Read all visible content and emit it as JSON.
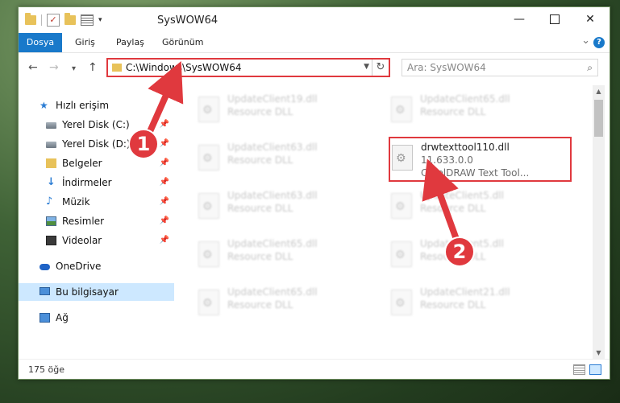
{
  "window": {
    "title": "SysWOW64"
  },
  "ribbon": {
    "tabs": [
      "Dosya",
      "Giriş",
      "Paylaş",
      "Görünüm"
    ]
  },
  "address": {
    "path": "C:\\Windows\\SysWOW64"
  },
  "search": {
    "placeholder": "Ara: SysWOW64"
  },
  "sidebar": {
    "items": [
      {
        "label": "Hızlı erişim",
        "icon": "star-icon"
      },
      {
        "label": "Yerel Disk (C:)",
        "icon": "disk-icon"
      },
      {
        "label": "Yerel Disk (D:)",
        "icon": "disk-icon"
      },
      {
        "label": "Belgeler",
        "icon": "folder-icon"
      },
      {
        "label": "İndirmeler",
        "icon": "download-icon"
      },
      {
        "label": "Müzik",
        "icon": "music-icon"
      },
      {
        "label": "Resimler",
        "icon": "pictures-icon"
      },
      {
        "label": "Videolar",
        "icon": "video-icon"
      },
      {
        "label": "OneDrive",
        "icon": "cloud-icon"
      },
      {
        "label": "Bu bilgisayar",
        "icon": "computer-icon"
      },
      {
        "label": "Ağ",
        "icon": "network-icon"
      }
    ]
  },
  "files": [
    {
      "name": "UpdateClient19.dll",
      "type": "Resource DLL"
    },
    {
      "name": "UpdateClient65.dll",
      "type": "Resource DLL"
    },
    {
      "name": "UpdateClient63.dll",
      "type": "Resource DLL"
    },
    {
      "name": "drwtexttool110.dll",
      "version": "11.633.0.0",
      "description": "CorelDRAW Text Tool..."
    },
    {
      "name": "UpdateClient63.dll",
      "type": "Resource DLL"
    },
    {
      "name": "UpdateClient5.dll",
      "type": "Resource DLL"
    },
    {
      "name": "UpdateClient65.dll",
      "type": "Resource DLL"
    },
    {
      "name": "UpdateClient5.dll",
      "type": "Resource DLL"
    },
    {
      "name": "UpdateClient65.dll",
      "type": "Resource DLL"
    },
    {
      "name": "UpdateClient21.dll",
      "type": "Resource DLL"
    }
  ],
  "status": {
    "count": "175 öğe"
  },
  "annotations": {
    "badge1": "1",
    "badge2": "2",
    "color": "#e0393e"
  }
}
